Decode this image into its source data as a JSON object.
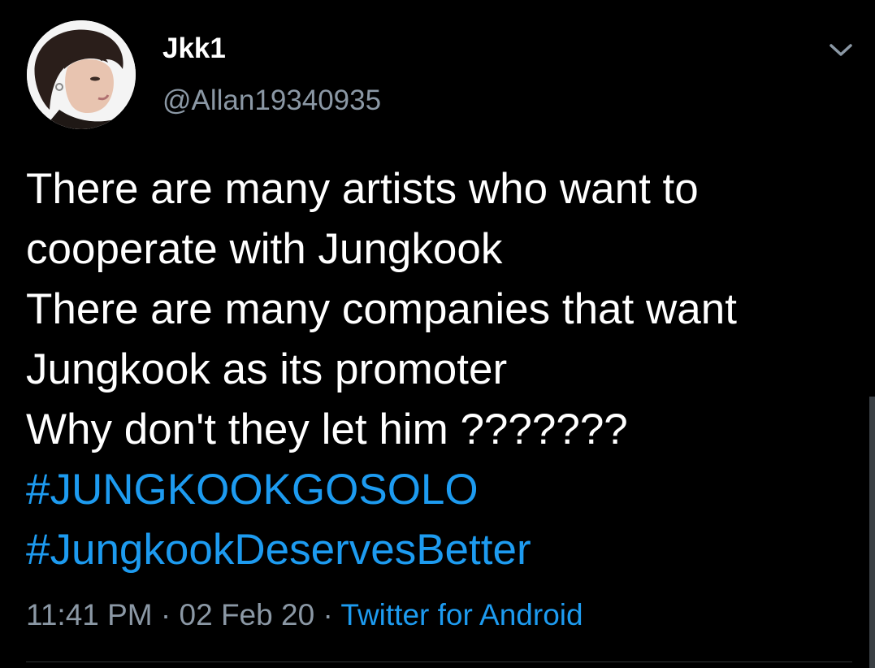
{
  "author": {
    "display_name": "Jkk1",
    "handle": "@Allan19340935"
  },
  "tweet": {
    "lines": [
      "There are many artists who want to",
      "cooperate with Jungkook",
      "There are many companies that want",
      "Jungkook as its promoter",
      "Why don't they let him ???????"
    ],
    "hashtags": [
      "#JUNGKOOKGOSOLO",
      "#JungkookDeservesBetter"
    ]
  },
  "meta": {
    "time": "11:41 PM",
    "separator": "·",
    "date": "02 Feb 20",
    "source": "Twitter for Android"
  },
  "icons": {
    "menu": "chevron-down-icon"
  },
  "colors": {
    "background": "#000000",
    "text": "#ffffff",
    "secondary": "#8b98a5",
    "link": "#1d9bf0"
  }
}
